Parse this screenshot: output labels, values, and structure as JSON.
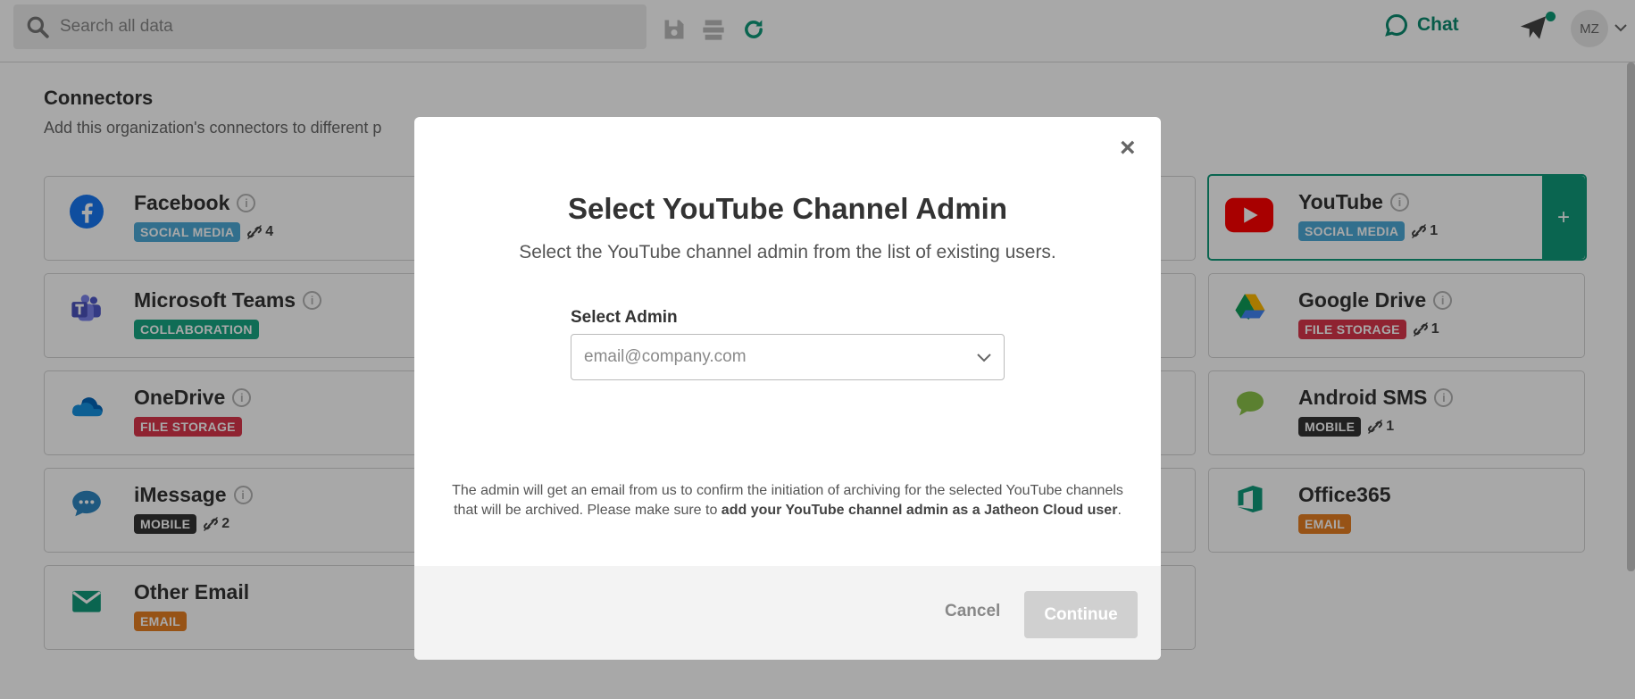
{
  "topbar": {
    "search_placeholder": "Search all data",
    "chat_label": "Chat",
    "avatar_initials": "MZ"
  },
  "page": {
    "title": "Connectors",
    "subtitle": "Add this organization's connectors to different p"
  },
  "connectors": [
    {
      "name": "Facebook",
      "category": "SOCIAL MEDIA",
      "count": "4"
    },
    {
      "name": "Microsoft Teams",
      "category": "COLLABORATION",
      "count": ""
    },
    {
      "name": "OneDrive",
      "category": "FILE STORAGE",
      "count": ""
    },
    {
      "name": "iMessage",
      "category": "MOBILE",
      "count": "2"
    },
    {
      "name": "Other Email",
      "category": "EMAIL",
      "count": ""
    },
    {
      "name": "YouTube",
      "category": "SOCIAL MEDIA",
      "count": "1"
    },
    {
      "name": "Google Drive",
      "category": "FILE STORAGE",
      "count": "1"
    },
    {
      "name": "Android SMS",
      "category": "MOBILE",
      "count": "1"
    },
    {
      "name": "Office365",
      "category": "EMAIL",
      "count": ""
    }
  ],
  "add_button_label": "+",
  "modal": {
    "close_label": "×",
    "title": "Select YouTube Channel Admin",
    "subtitle": "Select the YouTube channel admin from the list of existing users.",
    "field_label": "Select Admin",
    "field_placeholder": "email@company.com",
    "note_plain": "The admin will get an email from us to confirm the initiation of archiving for the selected YouTube channels that will be archived. Please make sure to ",
    "note_bold": "add your YouTube channel admin as a Jatheon Cloud user",
    "note_end": ".",
    "cancel_label": "Cancel",
    "continue_label": "Continue"
  },
  "colors": {
    "accent": "#10997a",
    "social": "#4da9d6",
    "collaboration": "#17a683",
    "file_storage": "#d9364b",
    "mobile": "#333333",
    "email": "#e67e22"
  }
}
